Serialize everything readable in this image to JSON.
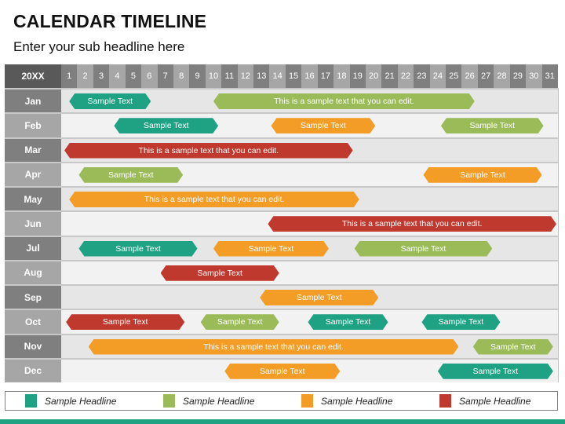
{
  "title": "CALENDAR TIMELINE",
  "subtitle": "Enter your sub headline here",
  "colors": {
    "teal": "#1fa283",
    "green": "#9bbb59",
    "orange": "#f39c26",
    "red": "#c0392f"
  },
  "header": {
    "year_label": "20XX",
    "days": [
      "1",
      "2",
      "3",
      "4",
      "5",
      "6",
      "7",
      "8",
      "9",
      "10",
      "11",
      "12",
      "13",
      "14",
      "15",
      "16",
      "17",
      "18",
      "19",
      "20",
      "21",
      "22",
      "23",
      "24",
      "25",
      "26",
      "27",
      "28",
      "29",
      "30",
      "31"
    ]
  },
  "months": [
    {
      "label": "Jan",
      "bars": [
        {
          "text": "Sample Text",
          "color": "teal",
          "start": 1.5,
          "end": 6.6
        },
        {
          "text": "This is a sample text that you can edit.",
          "color": "green",
          "start": 10.5,
          "end": 26.8
        }
      ]
    },
    {
      "label": "Feb",
      "bars": [
        {
          "text": "Sample Text",
          "color": "teal",
          "start": 4.3,
          "end": 10.8
        },
        {
          "text": "Sample Text",
          "color": "orange",
          "start": 14.1,
          "end": 20.6
        },
        {
          "text": "Sample Text",
          "color": "green",
          "start": 24.7,
          "end": 31.1
        }
      ]
    },
    {
      "label": "Mar",
      "bars": [
        {
          "text": "This is a sample text that you can edit.",
          "color": "red",
          "start": 1.2,
          "end": 19.2
        }
      ]
    },
    {
      "label": "Apr",
      "bars": [
        {
          "text": "Sample Text",
          "color": "green",
          "start": 2.1,
          "end": 8.6
        },
        {
          "text": "Sample Text",
          "color": "orange",
          "start": 23.6,
          "end": 31.0
        }
      ]
    },
    {
      "label": "May",
      "bars": [
        {
          "text": "This is a sample text that you can edit.",
          "color": "orange",
          "start": 1.5,
          "end": 19.6
        }
      ]
    },
    {
      "label": "Jun",
      "bars": [
        {
          "text": "This is a sample text that you can edit.",
          "color": "red",
          "start": 13.9,
          "end": 31.9
        }
      ]
    },
    {
      "label": "Jul",
      "bars": [
        {
          "text": "Sample Text",
          "color": "teal",
          "start": 2.1,
          "end": 9.5
        },
        {
          "text": "Sample Text",
          "color": "orange",
          "start": 10.5,
          "end": 17.7
        },
        {
          "text": "Sample Text",
          "color": "green",
          "start": 19.3,
          "end": 27.9
        }
      ]
    },
    {
      "label": "Aug",
      "bars": [
        {
          "text": "Sample Text",
          "color": "red",
          "start": 7.2,
          "end": 14.6
        }
      ]
    },
    {
      "label": "Sep",
      "bars": [
        {
          "text": "Sample Text",
          "color": "orange",
          "start": 13.4,
          "end": 20.8
        }
      ]
    },
    {
      "label": "Oct",
      "bars": [
        {
          "text": "Sample Text",
          "color": "red",
          "start": 1.3,
          "end": 8.7
        },
        {
          "text": "Sample Text",
          "color": "green",
          "start": 9.7,
          "end": 14.6
        },
        {
          "text": "Sample Text",
          "color": "teal",
          "start": 16.4,
          "end": 21.4
        },
        {
          "text": "Sample Text",
          "color": "teal",
          "start": 23.5,
          "end": 28.4
        }
      ]
    },
    {
      "label": "Nov",
      "bars": [
        {
          "text": "This is a sample text that you can edit.",
          "color": "orange",
          "start": 2.7,
          "end": 25.8
        },
        {
          "text": "Sample Text",
          "color": "green",
          "start": 26.7,
          "end": 31.7
        }
      ]
    },
    {
      "label": "Dec",
      "bars": [
        {
          "text": "Sample Text",
          "color": "orange",
          "start": 11.2,
          "end": 18.4
        },
        {
          "text": "Sample Text",
          "color": "teal",
          "start": 24.5,
          "end": 31.7
        }
      ]
    }
  ],
  "legend": [
    {
      "label": "Sample Headline",
      "color": "teal"
    },
    {
      "label": "Sample Headline",
      "color": "green"
    },
    {
      "label": "Sample Headline",
      "color": "orange"
    },
    {
      "label": "Sample Headline",
      "color": "red"
    }
  ]
}
